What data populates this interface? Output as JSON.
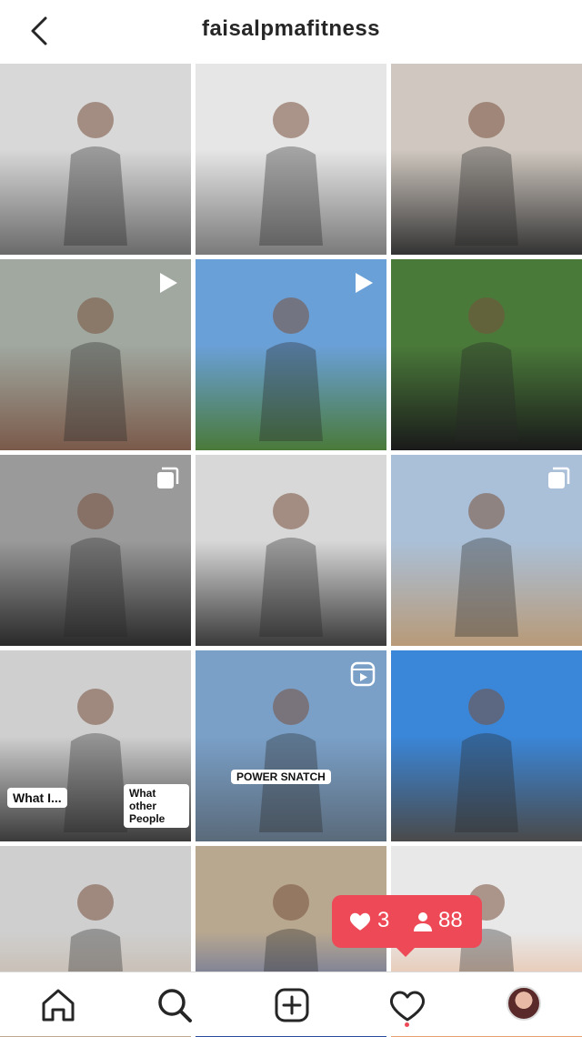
{
  "header": {
    "username": "faisalpmafitness"
  },
  "grid": {
    "tiles": [
      {
        "type": "photo",
        "colors": [
          "#d8d8d8",
          "#6a6a6a"
        ]
      },
      {
        "type": "photo",
        "colors": [
          "#e6e6e6",
          "#7a7a7a"
        ]
      },
      {
        "type": "photo",
        "colors": [
          "#d0c8c0",
          "#333333"
        ]
      },
      {
        "type": "video",
        "colors": [
          "#a0a8a0",
          "#7a5a4a"
        ]
      },
      {
        "type": "video",
        "colors": [
          "#6aa0d8",
          "#4a7a3a"
        ]
      },
      {
        "type": "photo",
        "colors": [
          "#4a7a3a",
          "#1a1a1a"
        ]
      },
      {
        "type": "carousel",
        "colors": [
          "#9a9a9a",
          "#2a2a2a"
        ]
      },
      {
        "type": "photo",
        "colors": [
          "#d8d8d8",
          "#3a3a3a"
        ]
      },
      {
        "type": "carousel",
        "colors": [
          "#aac0d8",
          "#b89a78"
        ]
      },
      {
        "type": "photo",
        "colors": [
          "#cfcfcf",
          "#3a3a3a"
        ]
      },
      {
        "type": "reel",
        "colors": [
          "#7aa0c8",
          "#5a6a7a"
        ]
      },
      {
        "type": "photo",
        "colors": [
          "#3a86d8",
          "#4a4a4a"
        ]
      },
      {
        "type": "photo",
        "colors": [
          "#cfcfcf",
          "#c0a890"
        ]
      },
      {
        "type": "photo",
        "colors": [
          "#b8a890",
          "#2a4aa0"
        ]
      },
      {
        "type": "photo",
        "colors": [
          "#e8e8e8",
          "#e8a070"
        ]
      }
    ],
    "captions": {
      "t13a": "What I...",
      "t13b": "What other People",
      "t11": "POWER SNATCH"
    }
  },
  "notification": {
    "likes": "3",
    "follows": "88"
  },
  "tabs": {
    "home": "home-icon",
    "search": "search-icon",
    "new_post": "add-post-icon",
    "activity": "heart-icon",
    "profile": "profile-avatar"
  },
  "colors": {
    "accent": "#ed4956",
    "text": "#262626"
  }
}
